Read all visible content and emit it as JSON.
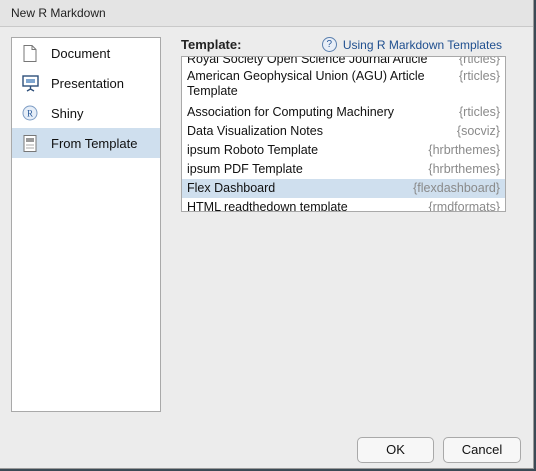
{
  "window": {
    "title": "New R Markdown"
  },
  "sidebar": {
    "items": [
      {
        "label": "Document",
        "icon": "document-icon"
      },
      {
        "label": "Presentation",
        "icon": "presentation-icon"
      },
      {
        "label": "Shiny",
        "icon": "shiny-r-icon"
      },
      {
        "label": "From Template",
        "icon": "template-icon",
        "selected": true
      }
    ]
  },
  "template": {
    "label": "Template:",
    "help_link": "Using R Markdown Templates",
    "help_icon": "question-circle-icon",
    "rows": [
      {
        "name": "Royal Society Open Science Journal Article",
        "pkg": "{rticles}"
      },
      {
        "name": "American Geophysical Union (AGU) Article",
        "name2": "Template",
        "pkg": "{rticles}"
      },
      {
        "name": "Association for Computing Machinery",
        "pkg": "{rticles}"
      },
      {
        "name": "Data Visualization Notes",
        "pkg": "{socviz}"
      },
      {
        "name": "ipsum Roboto Template",
        "pkg": "{hrbrthemes}"
      },
      {
        "name": "ipsum PDF Template",
        "pkg": "{hrbrthemes}"
      },
      {
        "name": "Flex Dashboard",
        "pkg": "{flexdashboard}",
        "selected": true
      },
      {
        "name": "HTML readthedown template",
        "pkg": "{rmdformats}"
      }
    ]
  },
  "buttons": {
    "ok": "OK",
    "cancel": "Cancel"
  }
}
